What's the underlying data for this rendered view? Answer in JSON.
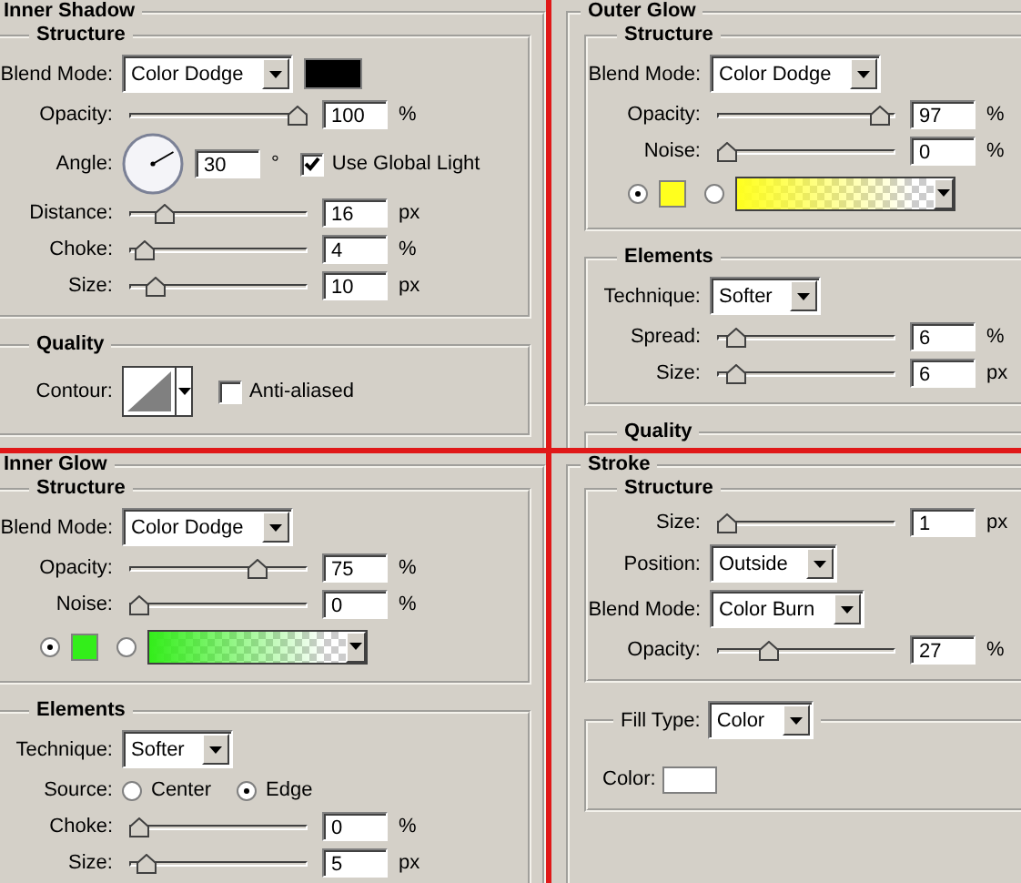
{
  "panels": [
    {
      "title": "Inner Shadow",
      "sections": [
        {
          "title": "Structure",
          "rows": [
            {
              "kind": "select",
              "label": "Blend Mode:",
              "value": "Color Dodge",
              "color": "#000000"
            },
            {
              "kind": "slider",
              "label": "Opacity:",
              "level": 1,
              "value": "100",
              "unit": "%"
            },
            {
              "kind": "angle",
              "label": "Angle:",
              "value": "30",
              "unit": "°",
              "checkbox": "Use Global Light",
              "checked": true
            },
            {
              "kind": "slider",
              "label": "Distance:",
              "level": 0.16,
              "value": "16",
              "unit": "px"
            },
            {
              "kind": "slider",
              "label": "Choke:",
              "level": 0.04,
              "value": "4",
              "unit": "%"
            },
            {
              "kind": "slider",
              "label": "Size:",
              "level": 0.1,
              "value": "10",
              "unit": "px"
            }
          ]
        },
        {
          "title": "Quality",
          "rows": [
            {
              "kind": "contour",
              "label": "Contour:",
              "checkbox": "Anti-aliased",
              "checked": false
            }
          ]
        }
      ]
    },
    {
      "title": "Outer Glow",
      "sections": [
        {
          "title": "Structure",
          "rows": [
            {
              "kind": "select",
              "label": "Blend Mode:",
              "value": "Color Dodge"
            },
            {
              "kind": "slider",
              "label": "Opacity:",
              "level": 0.97,
              "value": "97",
              "unit": "%"
            },
            {
              "kind": "slider",
              "label": "Noise:",
              "level": 0,
              "value": "0",
              "unit": "%"
            },
            {
              "kind": "colors",
              "options": [
                {
                  "kind": "solid",
                  "color": "#ffff1e",
                  "selected": true
                },
                {
                  "kind": "gradient",
                  "color": "#ffff1e",
                  "selected": false
                }
              ]
            }
          ]
        },
        {
          "title": "Elements",
          "rows": [
            {
              "kind": "select",
              "label": "Technique:",
              "value": "Softer"
            },
            {
              "kind": "slider",
              "label": "Spread:",
              "level": 0.06,
              "value": "6",
              "unit": "%"
            },
            {
              "kind": "slider",
              "label": "Size:",
              "level": 0.06,
              "value": "6",
              "unit": "px"
            }
          ]
        },
        {
          "title": "Quality"
        }
      ]
    },
    {
      "title": "Inner Glow",
      "sections": [
        {
          "title": "Structure",
          "rows": [
            {
              "kind": "select",
              "label": "Blend Mode:",
              "value": "Color Dodge"
            },
            {
              "kind": "slider",
              "label": "Opacity:",
              "level": 0.75,
              "value": "75",
              "unit": "%"
            },
            {
              "kind": "slider",
              "label": "Noise:",
              "level": 0,
              "value": "0",
              "unit": "%"
            },
            {
              "kind": "colors",
              "options": [
                {
                  "kind": "solid",
                  "color": "#33ee1a",
                  "selected": true
                },
                {
                  "kind": "gradient",
                  "color": "#33ee1a",
                  "selected": false
                }
              ]
            }
          ]
        },
        {
          "title": "Elements",
          "rows": [
            {
              "kind": "select",
              "label": "Technique:",
              "value": "Softer"
            },
            {
              "kind": "radio",
              "label": "Source:",
              "options": [
                {
                  "label": "Center",
                  "selected": false
                },
                {
                  "label": "Edge",
                  "selected": true
                }
              ]
            },
            {
              "kind": "slider",
              "label": "Choke:",
              "level": 0,
              "value": "0",
              "unit": "%"
            },
            {
              "kind": "slider",
              "label": "Size:",
              "level": 0.05,
              "value": "5",
              "unit": "px"
            }
          ]
        }
      ]
    },
    {
      "title": "Stroke",
      "sections": [
        {
          "title": "Structure",
          "rows": [
            {
              "kind": "slider",
              "label": "Size:",
              "level": 0,
              "value": "1",
              "unit": "px"
            },
            {
              "kind": "select",
              "label": "Position:",
              "value": "Outside"
            },
            {
              "kind": "select",
              "label": "Blend Mode:",
              "value": "Color Burn"
            },
            {
              "kind": "slider",
              "label": "Opacity:",
              "level": 0.27,
              "value": "27",
              "unit": "%"
            }
          ]
        },
        {
          "legend_select": {
            "label": "Fill Type:",
            "value": "Color"
          },
          "rows": [
            {
              "kind": "swatch",
              "label": "Color:",
              "color": "#ffffff"
            }
          ]
        }
      ]
    }
  ]
}
